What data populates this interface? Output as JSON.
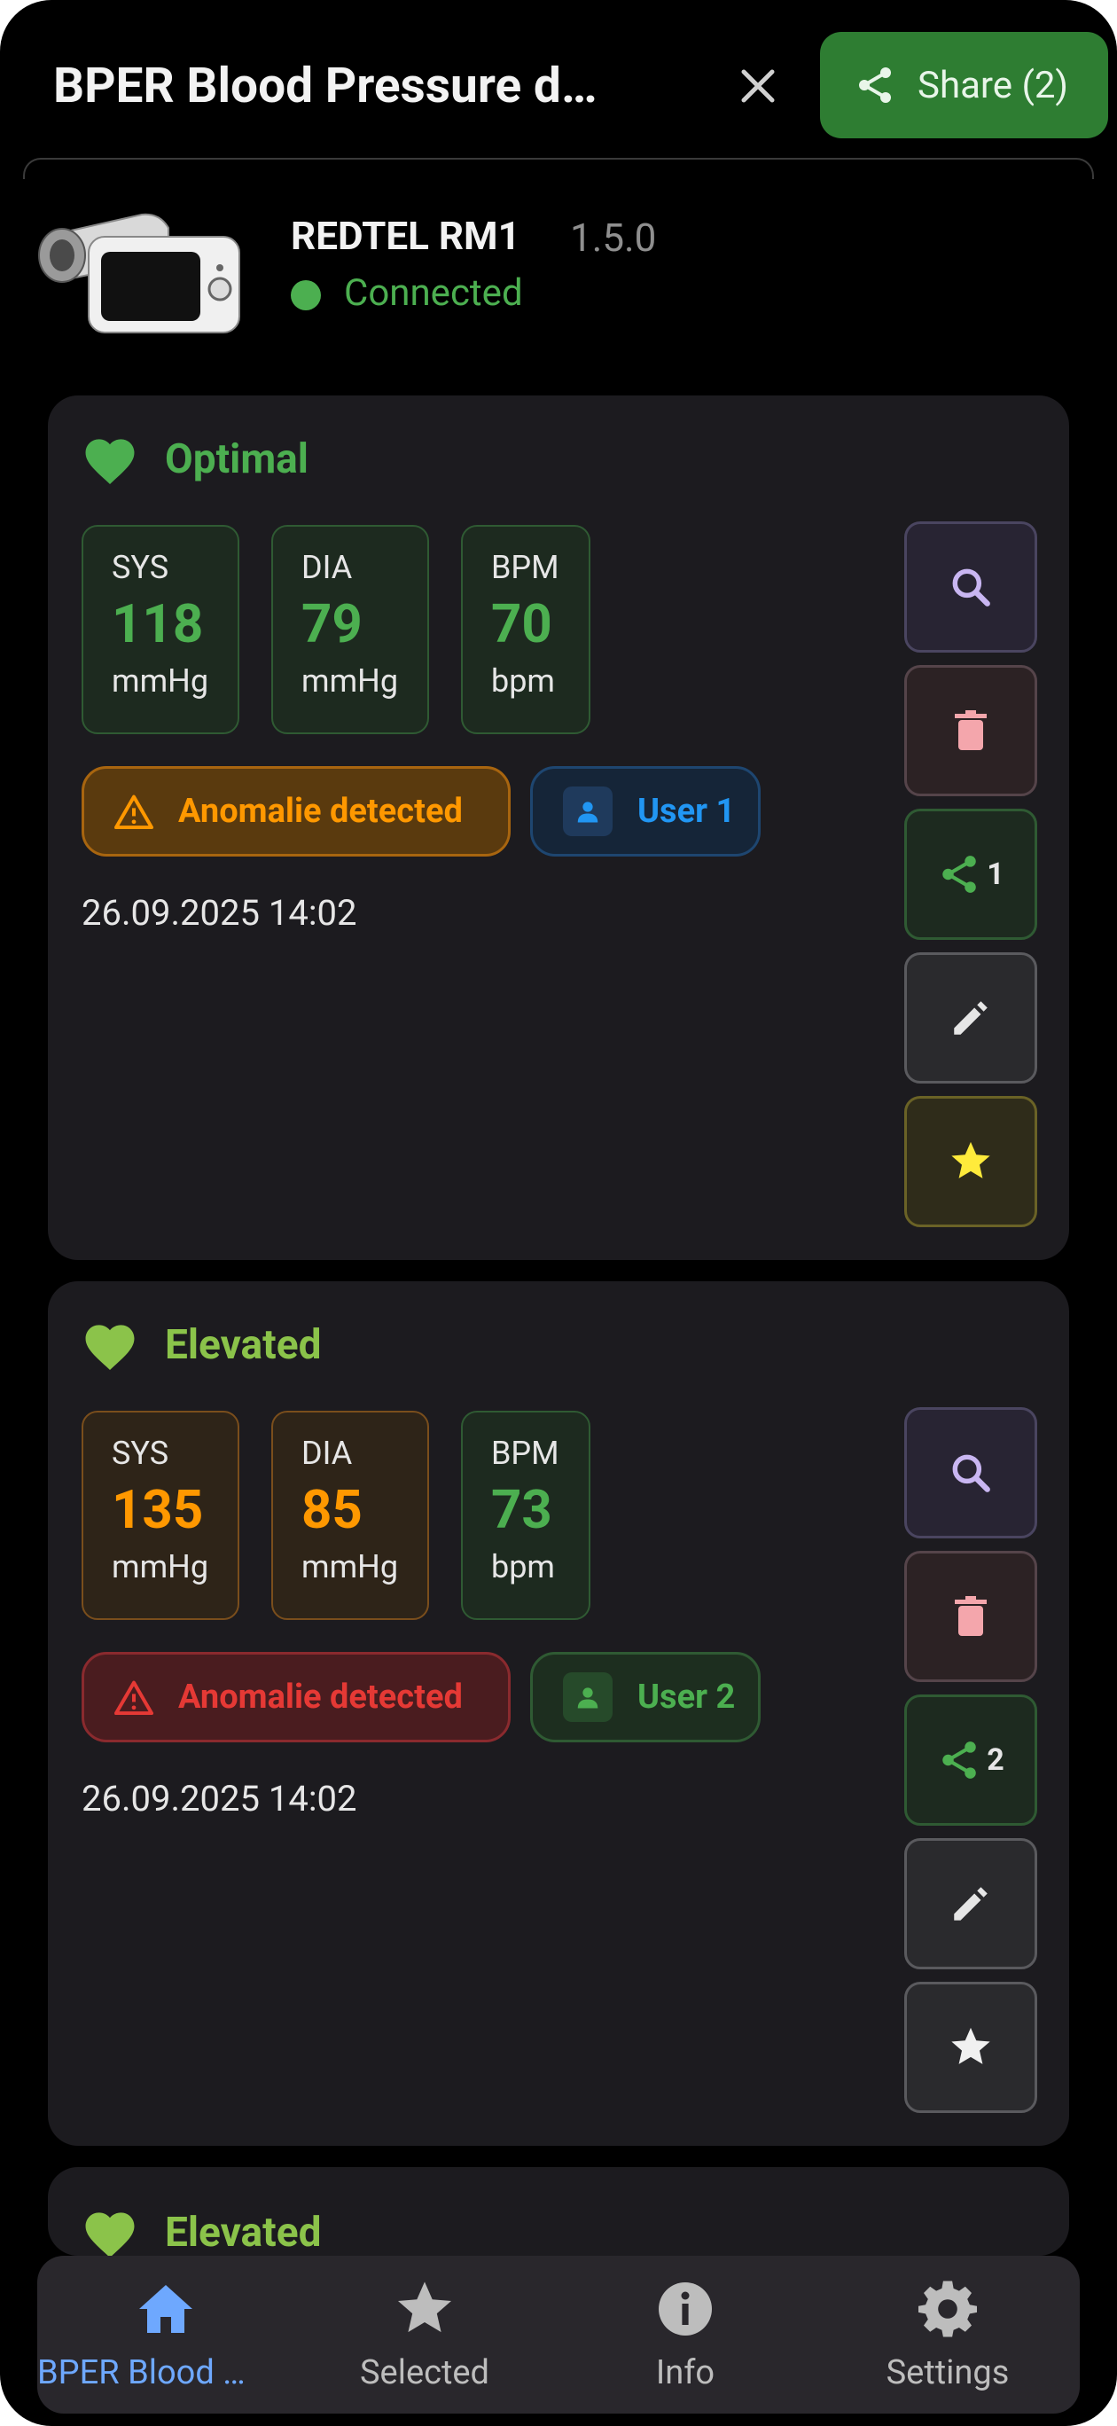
{
  "header": {
    "title": "BPER Blood Pressure d…",
    "share_label": "Share (2)"
  },
  "device": {
    "name": "REDTEL RM1",
    "version": "1.5.0",
    "status": "Connected"
  },
  "readings": [
    {
      "category": "Optimal",
      "category_color": "#4caf50",
      "sys_label": "SYS",
      "sys": "118",
      "sys_unit": "mmHg",
      "dia_label": "DIA",
      "dia": "79",
      "dia_unit": "mmHg",
      "bpm_label": "BPM",
      "bpm": "70",
      "bpm_unit": "bpm",
      "anomaly": "Anomalie detected",
      "anomaly_color": "#ff9800",
      "user": "User 1",
      "user_color": "#2196f3",
      "datetime": "26.09.2025 14:02",
      "share_count": "1",
      "favorite": true
    },
    {
      "category": "Elevated",
      "category_color": "#8bc34a",
      "sys_label": "SYS",
      "sys": "135",
      "sys_unit": "mmHg",
      "dia_label": "DIA",
      "dia": "85",
      "dia_unit": "mmHg",
      "bpm_label": "BPM",
      "bpm": "73",
      "bpm_unit": "bpm",
      "anomaly": "Anomalie detected",
      "anomaly_color": "#e53935",
      "user": "User 2",
      "user_color": "#4caf50",
      "datetime": "26.09.2025 14:02",
      "share_count": "2",
      "favorite": false
    },
    {
      "category": "Elevated",
      "category_color": "#8bc34a"
    }
  ],
  "nav": {
    "items": [
      {
        "label": "BPER Blood …",
        "icon": "home-icon",
        "active": true
      },
      {
        "label": "Selected",
        "icon": "star-icon",
        "active": false
      },
      {
        "label": "Info",
        "icon": "info-icon",
        "active": false
      },
      {
        "label": "Settings",
        "icon": "gear-icon",
        "active": false
      }
    ]
  },
  "colors": {
    "background": "#000000",
    "card": "#1c1b1f",
    "green": "#4caf50",
    "light_green": "#8bc34a",
    "orange": "#ff9800",
    "red": "#e53935",
    "blue": "#2196f3",
    "nav_active": "#6ea8fe",
    "nav_inactive": "#bdbdbd"
  }
}
